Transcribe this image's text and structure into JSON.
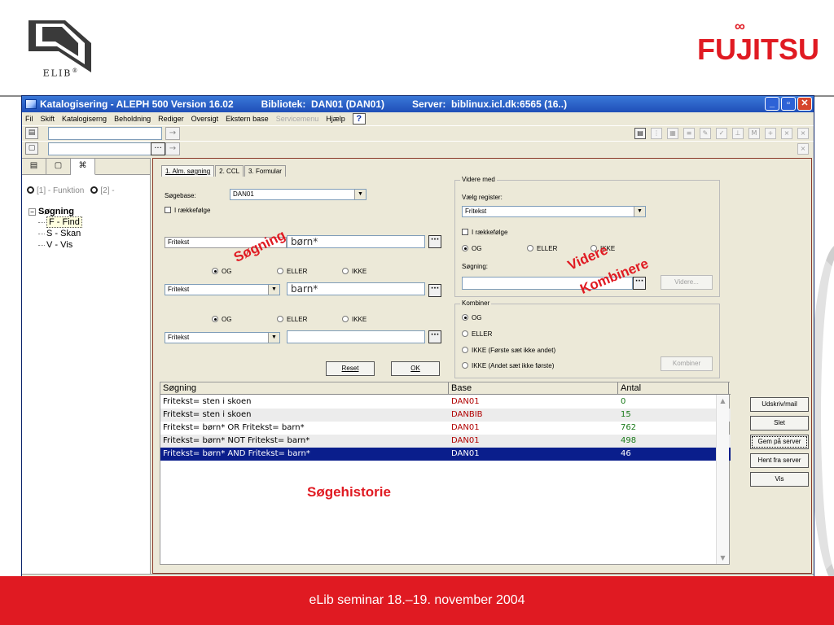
{
  "slide": {
    "logo_text": "ELIB",
    "logo_mark": "®",
    "brand": "FUJITSU",
    "footer": "eLib seminar 18.–19. november 2004"
  },
  "window": {
    "title_app": "Katalogisering - ALEPH 500 Version 16.02",
    "title_lib": "Bibliotek:  DAN01 (DAN01)",
    "title_server": "Server:  biblinux.icl.dk:6565 (16..)",
    "menu": [
      "Fil",
      "Skift",
      "Katalogiserng",
      "Beholdning",
      "Rediger",
      "Oversigt",
      "Ekstern base",
      "Servicemenu",
      "Hjælp"
    ],
    "help_icon": "?"
  },
  "left_panel": {
    "radio1": "[1] - Funktion",
    "radio2": "[2] -",
    "tree_root": "Søgning",
    "tree_items": [
      "F - Find",
      "S - Skan",
      "V - Vis"
    ]
  },
  "form": {
    "tabs": [
      "1. Alm. søgning",
      "2. CCL",
      "3. Formular"
    ],
    "sogebase_label": "Søgebase:",
    "sogebase_value": "DAN01",
    "raekkefolge": "I rækkefølge",
    "row1_field": "Fritekst",
    "row1_value": "børn*",
    "row2_field": "Fritekst",
    "row2_value": "barn*",
    "row3_field": "Fritekst",
    "row3_value": "",
    "og": "OG",
    "eller": "ELLER",
    "ikke": "IKKE",
    "reset": "Reset",
    "ok": "OK"
  },
  "videre": {
    "title": "Videre med",
    "vaelg_label": "Vælg register:",
    "vaelg_value": "Fritekst",
    "raekkefolge": "I rækkefølge",
    "og": "OG",
    "eller": "ELLER",
    "ikke": "IKKE",
    "sogning_label": "Søgning:",
    "videre_btn": "Videre..."
  },
  "kombiner": {
    "title": "Kombiner",
    "opt1": "OG",
    "opt2": "ELLER",
    "opt3": "IKKE (Første sæt ikke andet)",
    "opt4": "IKKE (Andet sæt ikke første)",
    "btn": "Kombiner"
  },
  "history": {
    "headers": [
      "Søgning",
      "Base",
      "Antal"
    ],
    "rows": [
      {
        "q": "Fritekst= sten i skoen",
        "base": "DAN01",
        "antal": "0"
      },
      {
        "q": "Fritekst= sten i skoen",
        "base": "DANBIB",
        "antal": "15"
      },
      {
        "q": "Fritekst= børn* OR Fritekst= barn*",
        "base": "DAN01",
        "antal": "762"
      },
      {
        "q": "Fritekst= børn* NOT Fritekst= barn*",
        "base": "DAN01",
        "antal": "498"
      },
      {
        "q": "Fritekst= børn* AND Fritekst= barn*",
        "base": "DAN01",
        "antal": "46"
      }
    ]
  },
  "side_buttons": [
    "Udskriv/mail",
    "Slet",
    "Gem på server",
    "Hent fra server",
    "Vis"
  ],
  "annotations": {
    "sogning": "Søgning",
    "videre": "Videre",
    "kombinere": "Kombinere",
    "sogehistorie": "Søgehistorie"
  },
  "colors": {
    "brand_red": "#e01a22",
    "titlebar_blue": "#2a5fc8",
    "selection_blue": "#0a1e8c"
  }
}
